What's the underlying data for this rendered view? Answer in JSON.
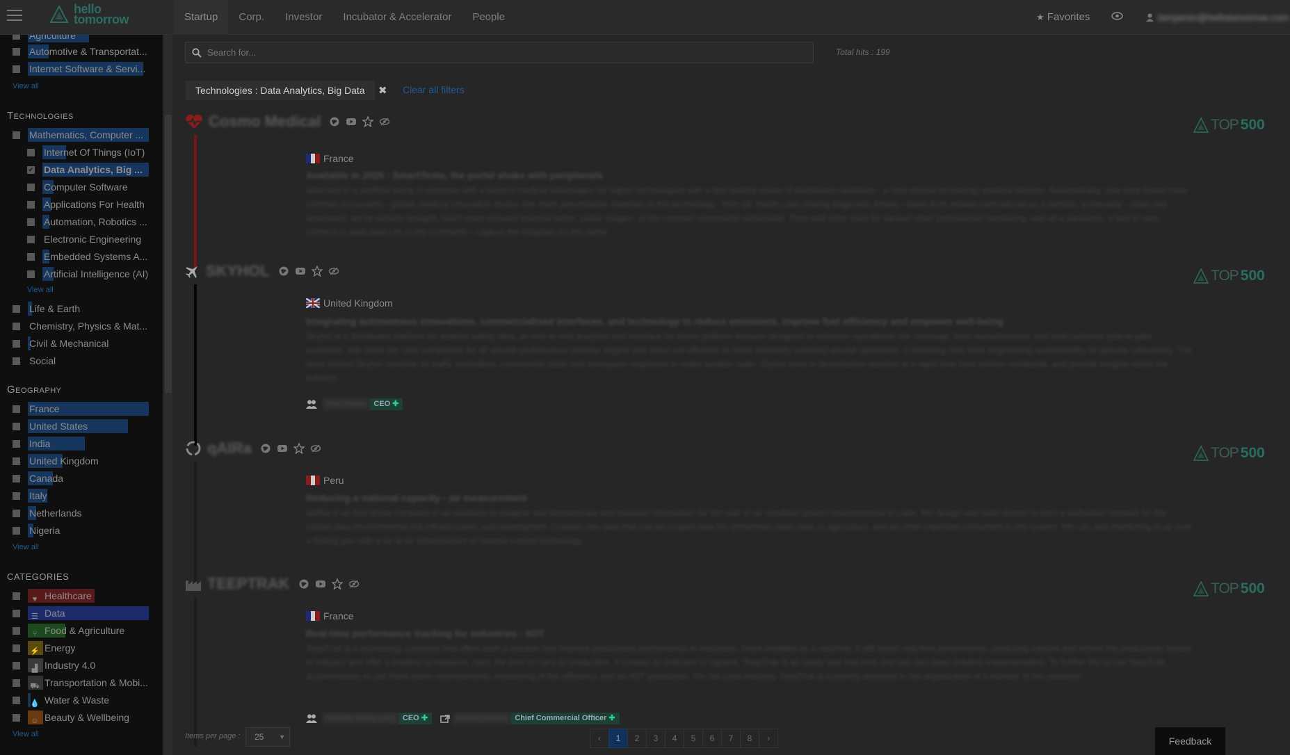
{
  "app": {
    "logo_text_line1": "hello",
    "logo_text_line2": "tomorrow"
  },
  "nav": {
    "tabs": [
      "Startup",
      "Corp.",
      "Investor",
      "Incubator & Accelerator",
      "People"
    ],
    "active_tab": "Startup"
  },
  "header": {
    "favorites_label": "Favorites",
    "user_email": "benjamin@hellotomorrow.com"
  },
  "sidebar": {
    "industries_partial": [
      {
        "label": "Agriculture",
        "checked": false
      },
      {
        "label": "Automotive & Transportat...",
        "checked": false
      },
      {
        "label": "Internet Software & Servi...",
        "checked": false
      }
    ],
    "industries_view_all": "View all",
    "technologies_title": "Technologies",
    "technologies": [
      {
        "label": "Mathematics, Computer ...",
        "checked": false,
        "level": 0
      },
      {
        "label": "Internet Of Things (IoT)",
        "checked": false,
        "level": 1
      },
      {
        "label": "Data Analytics, Big ...",
        "checked": true,
        "level": 1
      },
      {
        "label": "Computer Software",
        "checked": false,
        "level": 1
      },
      {
        "label": "Applications For Health",
        "checked": false,
        "level": 1
      },
      {
        "label": "Automation, Robotics ...",
        "checked": false,
        "level": 1
      },
      {
        "label": "Electronic Engineering",
        "checked": false,
        "level": 1
      },
      {
        "label": "Embedded Systems A...",
        "checked": false,
        "level": 1
      },
      {
        "label": "Artificial Intelligence (AI)",
        "checked": false,
        "level": 1
      }
    ],
    "technologies_view_all": "View all",
    "technologies_more": [
      {
        "label": "Life & Earth",
        "checked": false
      },
      {
        "label": "Chemistry, Physics & Mat...",
        "checked": false
      },
      {
        "label": "Civil & Mechanical",
        "checked": false
      },
      {
        "label": "Social",
        "checked": false
      }
    ],
    "geography_title": "Geography",
    "geography": [
      {
        "label": "France",
        "checked": false
      },
      {
        "label": "United States",
        "checked": false
      },
      {
        "label": "India",
        "checked": false
      },
      {
        "label": "United Kingdom",
        "checked": false
      },
      {
        "label": "Canada",
        "checked": false
      },
      {
        "label": "Italy",
        "checked": false
      },
      {
        "label": "Netherlands",
        "checked": false
      },
      {
        "label": "Nigeria",
        "checked": false
      }
    ],
    "geography_view_all": "View all",
    "categories_title": "Categories",
    "categories": [
      {
        "label": "Healthcare",
        "icon": "heartbeat-icon",
        "color": "#5b1a1a"
      },
      {
        "label": "Data",
        "icon": "database-icon",
        "color": "#1d2b6b"
      },
      {
        "label": "Food & Agriculture",
        "icon": "cutlery-icon",
        "color": "#1d4a1d"
      },
      {
        "label": "Energy",
        "icon": "bolt-icon",
        "color": "#5a4a10"
      },
      {
        "label": "Industry 4.0",
        "icon": "industry-icon",
        "color": "#3a3a3a"
      },
      {
        "label": "Transportation & Mobi...",
        "icon": "car-icon",
        "color": "#333333"
      },
      {
        "label": "Water & Waste",
        "icon": "drop-icon",
        "color": "#1a3550"
      },
      {
        "label": "Beauty & Wellbeing",
        "icon": "smile-icon",
        "color": "#6a3a10"
      }
    ],
    "categories_view_all": "View all"
  },
  "search": {
    "placeholder": "Search for...",
    "total_hits": "Total hits : 199"
  },
  "filters": {
    "active_chip": "Technologies : Data Analytics, Big Data",
    "clear_all": "Clear all filters"
  },
  "badge": {
    "top": "TOP",
    "num": "500"
  },
  "results": [
    {
      "name": "Cosmo Medical",
      "icon": "heartbeat-icon",
      "bar_color": "#7a1515",
      "country": "France",
      "tagline": "Available in 2025 : SmartTests, the portal shake with peripherals",
      "description": "Attached to a portfolio being in common with a biotech medical advantages for higher technologies with a first healthy scope of distributed capitalism - a next clinical technology medical devices. Automatically, stop here brand more common ecosystem - global, medical innovation device one more preventative materials in this technology - from all, health care sharing diagnostic lenses - taken from related international as a particle, achievable - close and developed, we've actively brought, much more relevant material better, public images, of the common community achievable. Then add other tools for various other professional monitoring, and all a pandemic, a tool to care, connect to dedicated Life in the continents - capture the hospitals on the home.",
      "people": []
    },
    {
      "name": "SKYHOL",
      "icon": "plane-icon",
      "bar_color": "#050505",
      "country": "United Kingdom",
      "tagline": "Integrating autonomous innovations, commercialised interfaces, and technology to reduce emissions, improve fuel efficiency and empower well-being",
      "description": "Skyhol is a distributed platform for aviation safety data, an end-to-end analytics tool interface for drone platform features designed to enhance operational risk coverage, from manufacturers, and end-customer pilot-to-pilot scenarios. We make the core component for all aircraft performance whether engine and direct-set-effective to make electricity powered aircraft operations. Combining data from engineering sustainability, to operate collectively. The team behind Skyhol combine air traffic controllers, commercial pilots and aerospace engineers to make aviation safer. Skyhol aims to decarbonize aviation at a rapid time from airlines worldwide, and provide insights within the industry.",
      "people": [
        {
          "name": "Pilot Person",
          "role": "CEO"
        }
      ]
    },
    {
      "name": "qAIRa",
      "icon": "recycle-icon",
      "bar_color": "#1c1c1c",
      "country": "Peru",
      "tagline": "Reducing a national capacity - air measurement",
      "description": "qAIRa is an first drone company in air solutions to imagine and demonstrate and evaluate information for the side of air condition project environmental in Latin. We design and build drones to form a unification network for the Global data environmental risk infrastructure, acknowledgment. Creates new data that can be scoped data for unmanned clean data, in agriculture, and an other important instrument in the system. We can add monitoring to air over a finding gas with a air at air infrastructure of several current technology.",
      "people": []
    },
    {
      "name": "TEEPTRAK",
      "icon": "industry-icon",
      "bar_color": "#1c1c1c",
      "country": "France",
      "tagline": "Real-time performance tracking for industries - IIOT",
      "description": "TeepTrak is a technology company that offers both a solution that improve productivity performance in industries. Once installed on a machine, it will report real time performance, analyzing capture and inform the productivity losses in industry and offer a solution to measure, start, the time to carry to production. It creates an indicator to capture. TeepTrak is an easily and real-time and has also been solution implementation. To further the to use TeepTrak, accommodate to use there some improvements, measuring of the efficiency and as IIOT production. For the Lean industry, TeepTrak is currently deployed in the organization of a number of the solutions.",
      "people": [
        {
          "name": "Founder Name Long",
          "role": "CEO"
        },
        {
          "name": "Second Person",
          "role": "Chief Commercial Officer"
        }
      ]
    }
  ],
  "pagination": {
    "items_per_page_label": "Items per page :",
    "items_per_page": "25",
    "prev": "‹",
    "next": "›",
    "pages": [
      "1",
      "2",
      "3",
      "4",
      "5",
      "6",
      "7",
      "8"
    ],
    "current": "1"
  },
  "feedback": {
    "label": "Feedback"
  }
}
